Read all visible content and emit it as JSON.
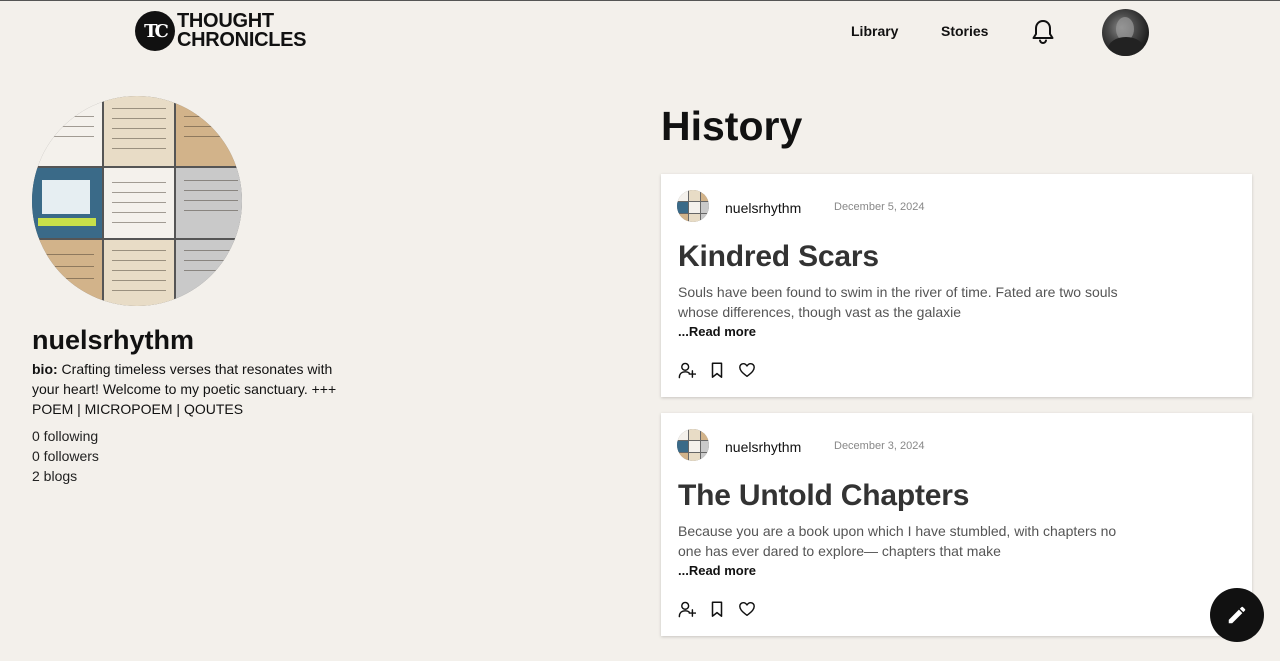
{
  "header": {
    "logo_line1": "THOUGHT",
    "logo_line2": "CHRONICLES",
    "logo_mark": "TC",
    "nav": [
      {
        "label": "Library"
      },
      {
        "label": "Stories"
      }
    ],
    "notification_icon": "bell-icon"
  },
  "profile": {
    "username": "nuelsrhythm",
    "bio_label": "bio:",
    "bio_text": " Crafting timeless verses that resonates with your heart! Welcome to my poetic sanctuary. +++ POEM | MICROPOEM | QOUTES",
    "following": "0 following",
    "followers": "0 followers",
    "blogs": "2 blogs"
  },
  "history": {
    "title": "History",
    "posts": [
      {
        "author": "nuelsrhythm",
        "date": "December 5, 2024",
        "title": "Kindred Scars",
        "excerpt": "Souls have been found to swim in the river of time. Fated are two souls whose differences, though vast as the galaxie",
        "read_more": "...Read more"
      },
      {
        "author": "nuelsrhythm",
        "date": "December 3, 2024",
        "title": "The Untold Chapters",
        "excerpt": "Because you are a book upon which I have stumbled, with chapters no one has ever dared to explore— chapters that make",
        "read_more": "...Read more"
      }
    ]
  },
  "icons": {
    "follow": "add-user-icon",
    "bookmark": "bookmark-icon",
    "like": "heart-icon",
    "fab": "pencil-icon"
  },
  "colors": {
    "background": "#f3f0eb",
    "card": "#ffffff",
    "accent": "#111111"
  }
}
